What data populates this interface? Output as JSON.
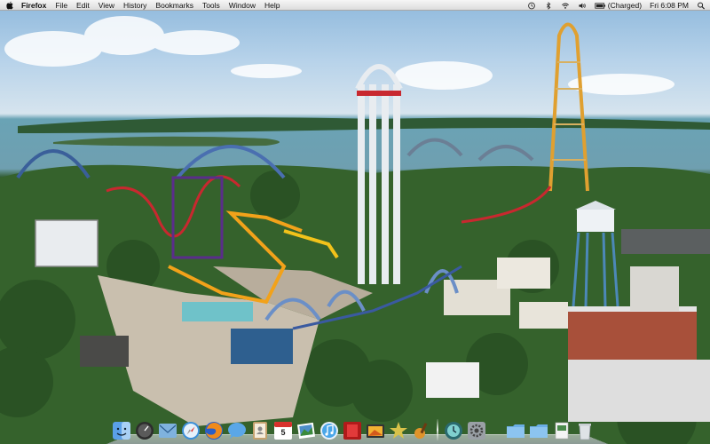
{
  "menubar": {
    "app_name": "Firefox",
    "menus": [
      "File",
      "Edit",
      "View",
      "History",
      "Bookmarks",
      "Tools",
      "Window",
      "Help"
    ],
    "battery_status": "(Charged)",
    "clock": "Fri 6:08 PM",
    "status_icons": [
      "time-machine-icon",
      "bluetooth-icon",
      "wifi-icon",
      "volume-icon",
      "battery-icon",
      "spotlight-icon"
    ]
  },
  "desktop": {
    "wallpaper": "amusement-park-aerial"
  },
  "dock": {
    "apps": [
      "finder",
      "dashboard",
      "mail",
      "safari",
      "firefox",
      "ichat",
      "address-book",
      "ical",
      "iphoto",
      "itunes",
      "photo-booth",
      "iwork",
      "garageband",
      "imovie",
      "time-machine",
      "system-preferences"
    ],
    "calendar_day": "5",
    "stacks": [
      "applications-folder",
      "documents-folder",
      "downloads-stack",
      "trash"
    ]
  },
  "colors": {
    "menubar": "#e8e8e8",
    "sky": "#9ec3e2",
    "lake": "#6fa3b6",
    "foliage": "#335f2c"
  }
}
